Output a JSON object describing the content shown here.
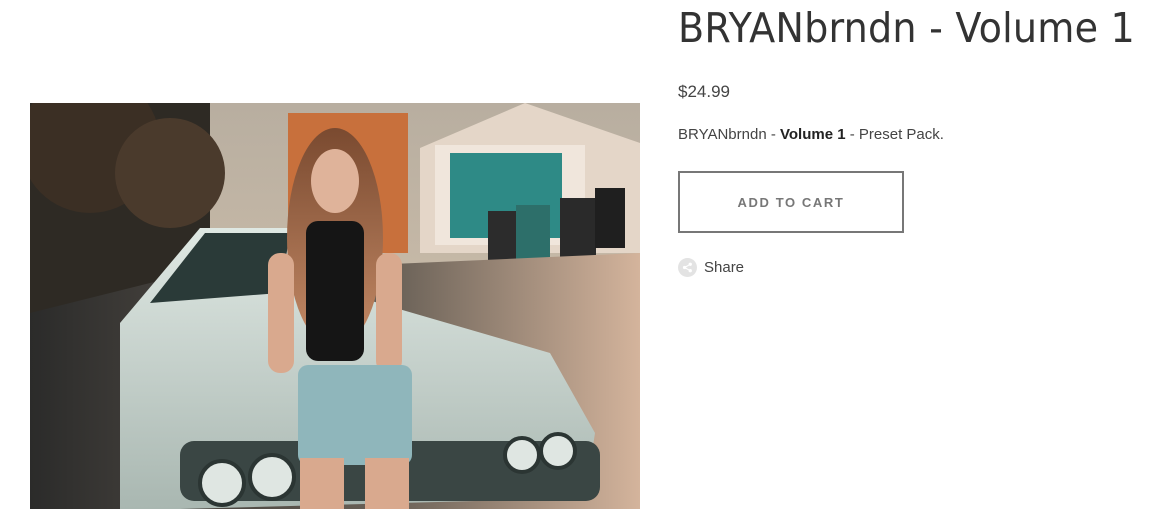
{
  "product": {
    "title": "BRYANbrndn - Volume 1",
    "price": "$24.99",
    "excerpt": {
      "prefix": "BRYANbrndn - ",
      "bold": "Volume 1",
      "suffix": " - Preset Pack."
    },
    "add_to_cart_label": "ADD TO CART",
    "share_label": "Share",
    "share_icon": "share-icon"
  }
}
